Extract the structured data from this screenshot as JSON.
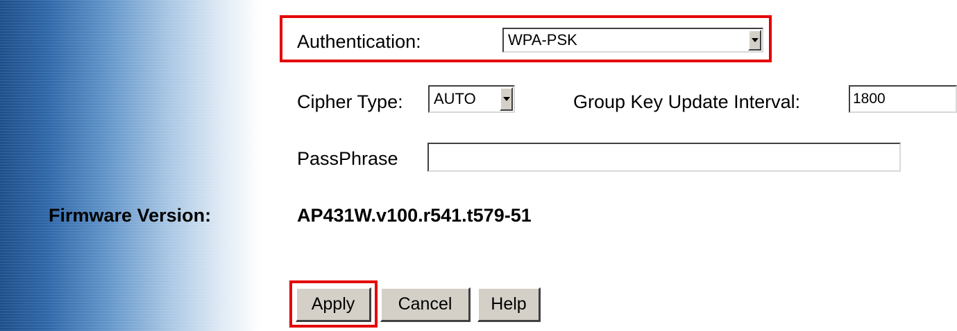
{
  "auth": {
    "label": "Authentication:",
    "value": "WPA-PSK"
  },
  "cipher": {
    "label": "Cipher Type:",
    "value": "AUTO"
  },
  "group_key": {
    "label": "Group Key Update Interval:",
    "value": "1800"
  },
  "passphrase": {
    "label": "PassPhrase",
    "value": ""
  },
  "firmware": {
    "label": "Firmware Version:",
    "value": "AP431W.v100.r541.t579-51"
  },
  "buttons": {
    "apply": "Apply",
    "cancel": "Cancel",
    "help": "Help"
  },
  "colors": {
    "highlight": "#e30000",
    "button_face": "#d4d0c8",
    "sidebar_dark": "#1f4f8a"
  },
  "icons": {
    "dropdown": "chevron-down-icon"
  }
}
